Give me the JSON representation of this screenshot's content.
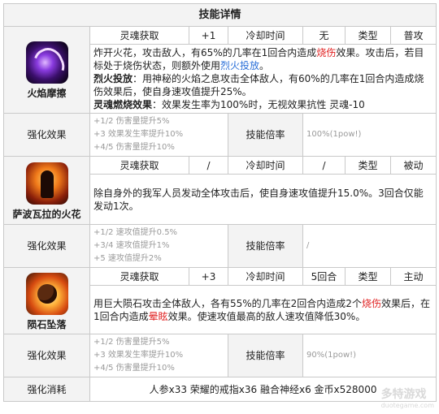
{
  "title": "技能详情",
  "meta_labels": {
    "soul": "灵魂获取",
    "cooldown": "冷却时间",
    "type": "类型"
  },
  "enhance_label": "强化效果",
  "ratio_label": "技能倍率",
  "skills": [
    {
      "name": "火焰摩擦",
      "soul": "+1",
      "cooldown": "无",
      "type": "普攻",
      "desc": {
        "p1_a": "炸开火花，攻击敌人，有65%的几率在1回合内造成",
        "p1_kw": "烧伤",
        "p1_b": "效果。攻击后，若目标处于烧伤状态，则额外使用",
        "p1_kw2": "烈火投放",
        "p1_c": "。",
        "p2_title": "烈火投放",
        "p2_text": "：用神秘的火焰之息攻击全体敌人，有60%的几率在1回合内造成烧伤效果后，使自身速攻值提升25%。",
        "p3_title": "灵魂燃烧效果",
        "p3_text": "：效果发生率为100%时，无视效果抗性 灵魂-10"
      },
      "enhance": [
        "+1/2 伤害量提升5%",
        "+3 效果发生率提升10%",
        "+4/5 伤害量提升10%"
      ],
      "ratio": "100%(1pow!)"
    },
    {
      "name": "萨波瓦拉的火花",
      "soul": "/",
      "cooldown": "/",
      "type": "被动",
      "desc": {
        "text": "除自身外的我军人员发动全体攻击后，使自身速攻值提升15.0%。3回合仅能发动1次。"
      },
      "enhance": [
        "+1/2 速攻值提升0.5%",
        "+3/4 速攻值提升1%",
        "+5 速攻值提升2%"
      ],
      "ratio": "/"
    },
    {
      "name": "陨石坠落",
      "soul": "+3",
      "cooldown": "5回合",
      "type": "主动",
      "desc": {
        "a": "用巨大陨石攻击全体敌人，各有55%的几率在2回合内造成2个",
        "kw": "烧伤",
        "b": "效果后，在1回合内造成",
        "kw2": "晕眩",
        "c": "效果。使速攻值最高的敌人速攻值降低30%。"
      },
      "enhance": [
        "+1/2 伤害量提升5%",
        "+3 效果发生率提升10%",
        "+4/5 伤害量提升10%"
      ],
      "ratio": "90%(1pow!)"
    }
  ],
  "cost_label": "强化消耗",
  "cost_value": "人参x33 荣耀的戒指x36 融合神经x6 金币x528000",
  "watermark": {
    "text": "多特游戏",
    "url": "duotegame.com"
  },
  "colors": {
    "keyword_red": "#e02020",
    "keyword_blue": "#2a6fd8",
    "header_bg": "#f3f3f3",
    "border": "#c9c9c9"
  }
}
